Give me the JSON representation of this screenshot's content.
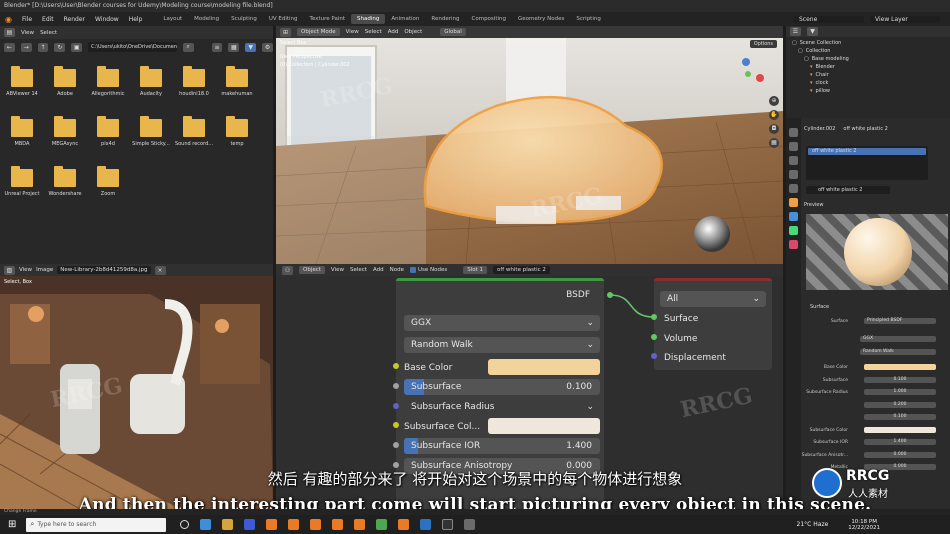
{
  "window": {
    "title": "Blender* [D:\\Users\\User\\Blender courses for Udemy\\Modeling course\\modeling file.blend]"
  },
  "menubar": {
    "menus": [
      "File",
      "Edit",
      "Render",
      "Window",
      "Help"
    ],
    "workspaces": [
      "Layout",
      "Modeling",
      "Sculpting",
      "UV Editing",
      "Texture Paint",
      "Shading",
      "Animation",
      "Rendering",
      "Compositing",
      "Geometry Nodes",
      "Scripting"
    ],
    "active_workspace": "Shading",
    "scene": "Scene",
    "view_layer": "View Layer"
  },
  "file_browser": {
    "menus": [
      "View",
      "Select"
    ],
    "path": "C:\\Users\\ukito\\OneDrive\\Documen...",
    "folders": [
      "ABViewer 14",
      "Adobe",
      "Allegorithmic",
      "Audacity",
      "houdini18.0",
      "makehuman",
      "MBDA",
      "MEGAsync",
      "pix4d",
      "Simple Sticky...",
      "Sound record...",
      "temp",
      "Unreal Project",
      "Wondershare",
      "Zoom"
    ]
  },
  "viewport": {
    "select_mode": "Select Box",
    "mode": "Object Mode",
    "menus": [
      "View",
      "Select",
      "Add",
      "Object"
    ],
    "transform": "Global",
    "options": "Options",
    "overlay_line1": "User Perspective",
    "overlay_line2": "(0) Collection | Cylinder.002"
  },
  "image_editor": {
    "menus": [
      "View",
      "Image"
    ],
    "image_name": "New-Library-2b8d41259d8a.jpg",
    "footer": "Select, Box"
  },
  "node_editor": {
    "object_mode": "Object",
    "menus": [
      "View",
      "Select",
      "Add",
      "Node"
    ],
    "use_nodes": "Use Nodes",
    "slot": "Slot 1",
    "material": "off white plastic 2",
    "bsdf_output": "BSDF",
    "distribution": "GGX",
    "subsurface_method": "Random Walk",
    "base_color_label": "Base Color",
    "base_color_hex": "#f2d39c",
    "subsurface_label": "Subsurface",
    "subsurface_value": "0.100",
    "subsurface_fraction": 0.1,
    "subsurface_radius_label": "Subsurface Radius",
    "subsurface_color_label": "Subsurface Col...",
    "subsurface_color_hex": "#efe6dc",
    "subsurface_ior_label": "Subsurface IOR",
    "subsurface_ior_value": "1.400",
    "subsurface_anisotropy_label": "Subsurface Anisotropy",
    "subsurface_anisotropy_value": "0.000",
    "output_target": "All",
    "output_sockets": [
      "Surface",
      "Volume",
      "Displacement"
    ]
  },
  "outliner": {
    "title": "Scene Collection",
    "rows": [
      "Collection",
      "Base modeling",
      "Blender",
      "Chair",
      "clock",
      "pillow"
    ]
  },
  "properties": {
    "object": "Cylinder.002",
    "material_header": "off white plastic 2",
    "slot_item": "off white plastic 2",
    "material_field": "off white plastic 2",
    "preview_label": "Preview",
    "surface_label": "Surface",
    "surface_shader_label": "Surface",
    "surface_shader_value": "Principled BSDF",
    "distribution": "GGX",
    "method": "Random Walk",
    "rows": [
      {
        "label": "Base Color",
        "value": ""
      },
      {
        "label": "Subsurface",
        "value": "0.100"
      },
      {
        "label": "Subsurface Radius",
        "value": "1.000"
      },
      {
        "label": "",
        "value": "0.200"
      },
      {
        "label": "",
        "value": "0.100"
      },
      {
        "label": "Subsurface Color",
        "value": ""
      },
      {
        "label": "Subsurface IOR",
        "value": "1.400"
      },
      {
        "label": "Subsurface Anisotr...",
        "value": "0.000"
      },
      {
        "label": "Metallic",
        "value": "0.000"
      }
    ]
  },
  "statusbar": {
    "text": "Change Frame"
  },
  "taskbar": {
    "search_placeholder": "Type here to search",
    "weather": "21°C Haze",
    "time": "10:18 PM",
    "date": "12/22/2021"
  },
  "subtitles": {
    "chinese": "然后 有趣的部分来了 将开始对这个场景中的每个物体进行想象",
    "english": "And then the interesting part come will start picturing every object in this scene."
  },
  "watermark": {
    "text": "RRCG",
    "logo_text": "RRCG",
    "logo_subtext": "人人素材"
  },
  "colors": {
    "accent": "#4772b3",
    "folder": "#e8b64a",
    "selection_orange": "#f0a040",
    "node_header_green": "#3c9a3c",
    "socket_yellow": "#c7c729",
    "socket_grey": "#a1a1a1",
    "socket_purple": "#6363c7",
    "socket_green": "#63c763"
  }
}
